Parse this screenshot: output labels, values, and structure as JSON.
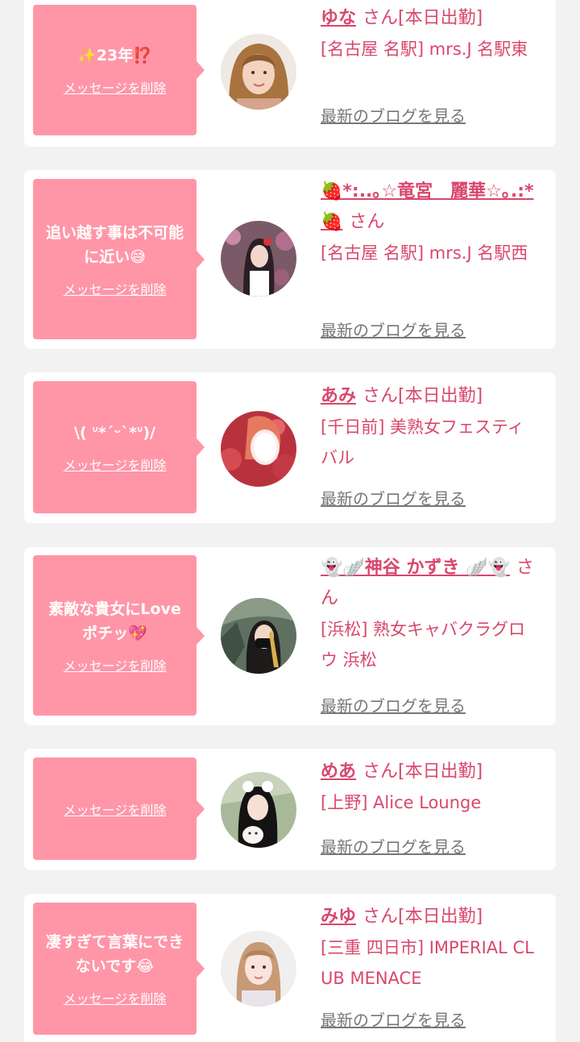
{
  "labels": {
    "delete_message": "メッセージを削除",
    "latest_blog": "最新のブログを見る",
    "honorific": "さん"
  },
  "colors": {
    "accent": "#d9476c",
    "bubble": "#ff96a8",
    "link_gray": "#777777",
    "background": "#f2f2f2"
  },
  "cards": [
    {
      "message": "✨23年⁉️",
      "name": "ゆな",
      "status": "[本日出勤]",
      "shop": "[名古屋 名駅] mrs.J 名駅東",
      "avatar_icon": "profile-photo-yuna"
    },
    {
      "message": "追い越す事は不可能に近い😅",
      "name": "🍓*:..｡☆竜宮　麗華☆｡.:*🍓",
      "status": "",
      "shop": "[名古屋 名駅] mrs.J 名駅西",
      "avatar_icon": "profile-photo-reika"
    },
    {
      "message": "\\( ᐡ*ˊᵕˋ*ᐡ)/",
      "name": "あみ",
      "status": "[本日出勤]",
      "shop": "[千日前] 美熟女フェスティバル",
      "avatar_icon": "profile-photo-ami"
    },
    {
      "message": "素敵な貴女にLoveポチッ💖",
      "name": "👻🪽神谷 かずき 🪽👻",
      "status": "",
      "shop": "[浜松] 熟女キャバクラグロウ 浜松",
      "avatar_icon": "profile-photo-kazuki"
    },
    {
      "message": "",
      "name": "めあ",
      "status": "[本日出勤]",
      "shop": "[上野] Alice Lounge",
      "avatar_icon": "profile-photo-mea"
    },
    {
      "message": "凄すぎて言葉にできないです😂",
      "name": "みゆ",
      "status": "[本日出勤]",
      "shop": "[三重 四日市] IMPERIAL CLUB MENACE",
      "avatar_icon": "profile-photo-miyu"
    }
  ]
}
